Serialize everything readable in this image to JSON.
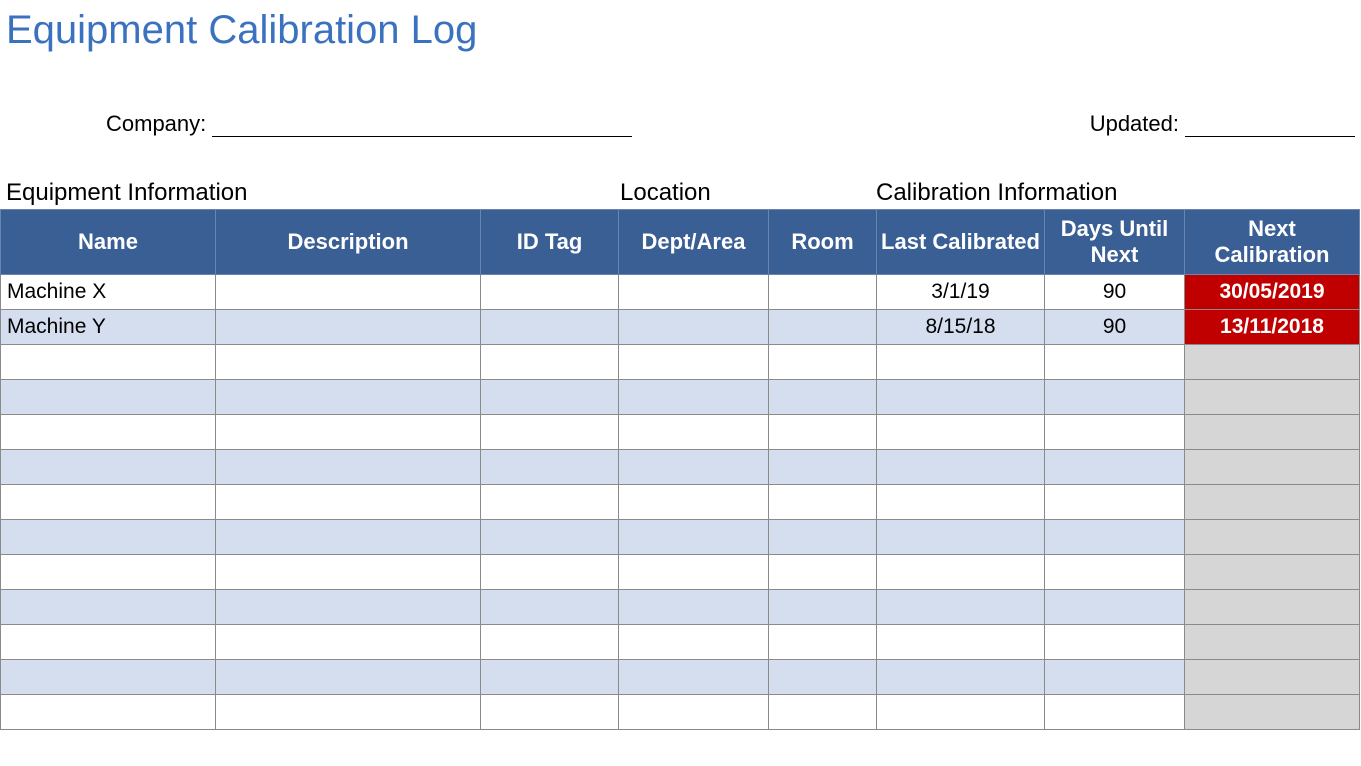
{
  "title": "Equipment Calibration Log",
  "meta": {
    "company_label": "Company:",
    "company_value": "",
    "updated_label": "Updated:",
    "updated_value": ""
  },
  "sections": {
    "equipment": "Equipment Information",
    "location": "Location",
    "calibration": "Calibration Information"
  },
  "headers": {
    "name": "Name",
    "description": "Description",
    "id_tag": "ID Tag",
    "dept_area": "Dept/Area",
    "room": "Room",
    "last_calibrated": "Last Calibrated",
    "days_until_next": "Days Until Next",
    "next_calibration": "Next Calibration"
  },
  "rows": [
    {
      "name": "Machine X",
      "description": "",
      "id_tag": "",
      "dept_area": "",
      "room": "",
      "last_calibrated": "3/1/19",
      "days_until_next": "90",
      "next_calibration": "30/05/2019",
      "next_alert": true
    },
    {
      "name": "Machine Y",
      "description": "",
      "id_tag": "",
      "dept_area": "",
      "room": "",
      "last_calibrated": "8/15/18",
      "days_until_next": "90",
      "next_calibration": "13/11/2018",
      "next_alert": true
    },
    {
      "name": "",
      "description": "",
      "id_tag": "",
      "dept_area": "",
      "room": "",
      "last_calibrated": "",
      "days_until_next": "",
      "next_calibration": "",
      "next_alert": false
    },
    {
      "name": "",
      "description": "",
      "id_tag": "",
      "dept_area": "",
      "room": "",
      "last_calibrated": "",
      "days_until_next": "",
      "next_calibration": "",
      "next_alert": false
    },
    {
      "name": "",
      "description": "",
      "id_tag": "",
      "dept_area": "",
      "room": "",
      "last_calibrated": "",
      "days_until_next": "",
      "next_calibration": "",
      "next_alert": false
    },
    {
      "name": "",
      "description": "",
      "id_tag": "",
      "dept_area": "",
      "room": "",
      "last_calibrated": "",
      "days_until_next": "",
      "next_calibration": "",
      "next_alert": false
    },
    {
      "name": "",
      "description": "",
      "id_tag": "",
      "dept_area": "",
      "room": "",
      "last_calibrated": "",
      "days_until_next": "",
      "next_calibration": "",
      "next_alert": false
    },
    {
      "name": "",
      "description": "",
      "id_tag": "",
      "dept_area": "",
      "room": "",
      "last_calibrated": "",
      "days_until_next": "",
      "next_calibration": "",
      "next_alert": false
    },
    {
      "name": "",
      "description": "",
      "id_tag": "",
      "dept_area": "",
      "room": "",
      "last_calibrated": "",
      "days_until_next": "",
      "next_calibration": "",
      "next_alert": false
    },
    {
      "name": "",
      "description": "",
      "id_tag": "",
      "dept_area": "",
      "room": "",
      "last_calibrated": "",
      "days_until_next": "",
      "next_calibration": "",
      "next_alert": false
    },
    {
      "name": "",
      "description": "",
      "id_tag": "",
      "dept_area": "",
      "room": "",
      "last_calibrated": "",
      "days_until_next": "",
      "next_calibration": "",
      "next_alert": false
    },
    {
      "name": "",
      "description": "",
      "id_tag": "",
      "dept_area": "",
      "room": "",
      "last_calibrated": "",
      "days_until_next": "",
      "next_calibration": "",
      "next_alert": false
    },
    {
      "name": "",
      "description": "",
      "id_tag": "",
      "dept_area": "",
      "room": "",
      "last_calibrated": "",
      "days_until_next": "",
      "next_calibration": "",
      "next_alert": false
    }
  ]
}
